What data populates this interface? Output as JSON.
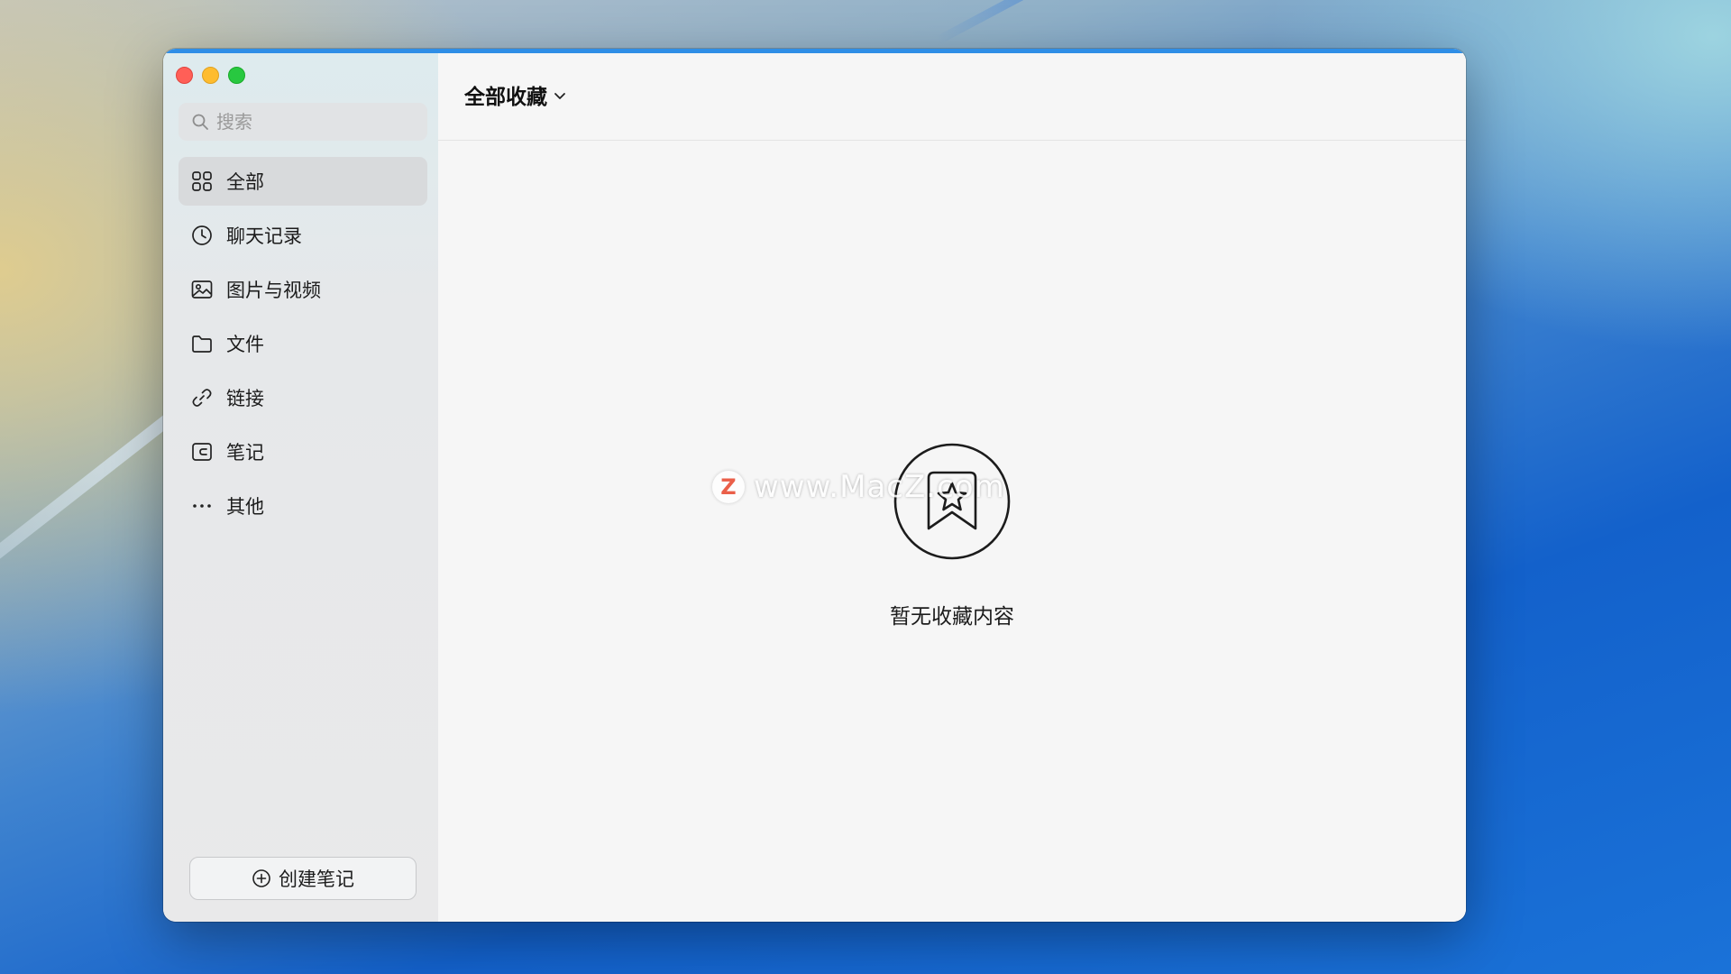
{
  "window": {
    "controls": [
      "close",
      "minimize",
      "maximize"
    ]
  },
  "sidebar": {
    "search": {
      "placeholder": "搜索",
      "icon": "search-icon"
    },
    "items": [
      {
        "label": "全部",
        "icon": "grid-icon",
        "active": true
      },
      {
        "label": "聊天记录",
        "icon": "clock-icon",
        "active": false
      },
      {
        "label": "图片与视频",
        "icon": "image-icon",
        "active": false
      },
      {
        "label": "文件",
        "icon": "folder-icon",
        "active": false
      },
      {
        "label": "链接",
        "icon": "link-icon",
        "active": false
      },
      {
        "label": "笔记",
        "icon": "note-icon",
        "active": false
      },
      {
        "label": "其他",
        "icon": "more-icon",
        "active": false
      }
    ],
    "create_note_label": "创建笔记"
  },
  "main": {
    "title": "全部收藏",
    "empty_text": "暂无收藏内容",
    "empty_icon": "bookmark-star-icon"
  },
  "watermark": {
    "logo": "Z",
    "text": "www.MacZ.com"
  },
  "colors": {
    "accent_bar": "#2f8ee6",
    "sidebar_active": "#d8dadc",
    "traffic_close": "#ff5f57",
    "traffic_min": "#febc2e",
    "traffic_max": "#28c840"
  }
}
